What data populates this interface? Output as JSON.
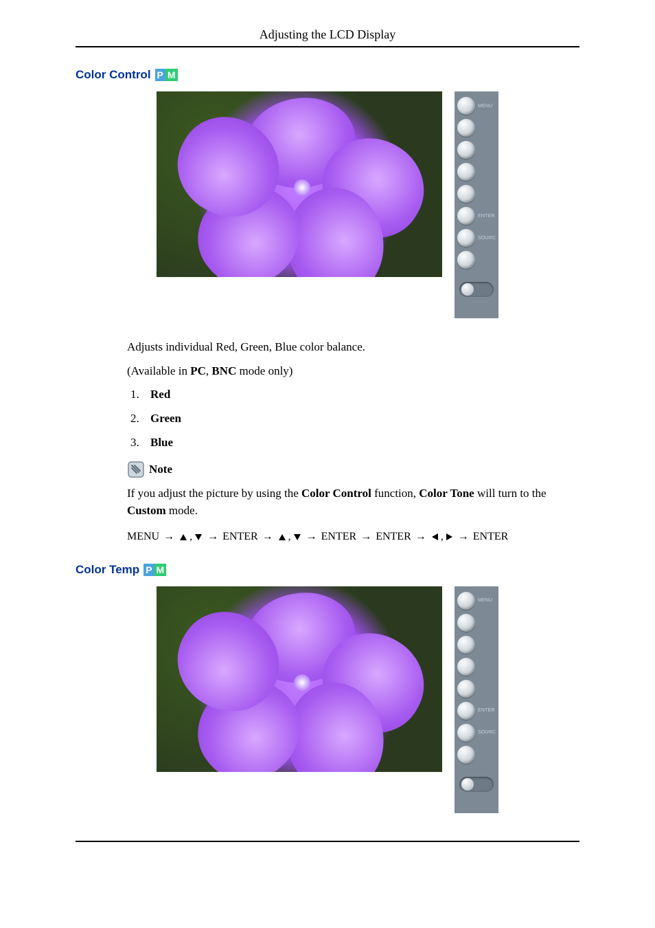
{
  "page_header": "Adjusting the LCD Display",
  "sections": {
    "color_control": {
      "heading": "Color Control",
      "badge_p": "P",
      "badge_m": "M",
      "description": "Adjusts individual Red, Green, Blue color balance.",
      "availability_prefix": "(Available in ",
      "availability_mode1": "PC",
      "availability_sep": ", ",
      "availability_mode2": "BNC",
      "availability_suffix": " mode only)",
      "list": {
        "item1": "Red",
        "item2": "Green",
        "item3": "Blue"
      },
      "note_label": "Note",
      "note_text_prefix": "If you adjust the picture by using the ",
      "note_bold1": "Color Control",
      "note_mid1": " function, ",
      "note_bold2": "Color Tone",
      "note_mid2": " will turn to the ",
      "note_bold3": "Custom",
      "note_suffix": " mode.",
      "nav": {
        "menu": "MENU",
        "enter": "ENTER",
        "arrow": "→",
        "comma": ","
      }
    },
    "color_temp": {
      "heading": "Color Temp",
      "badge_p": "P",
      "badge_m": "M"
    }
  },
  "control_strip": {
    "labels": [
      "MENU",
      "",
      "",
      "",
      "",
      "ENTER",
      "SOURCE",
      ""
    ]
  }
}
